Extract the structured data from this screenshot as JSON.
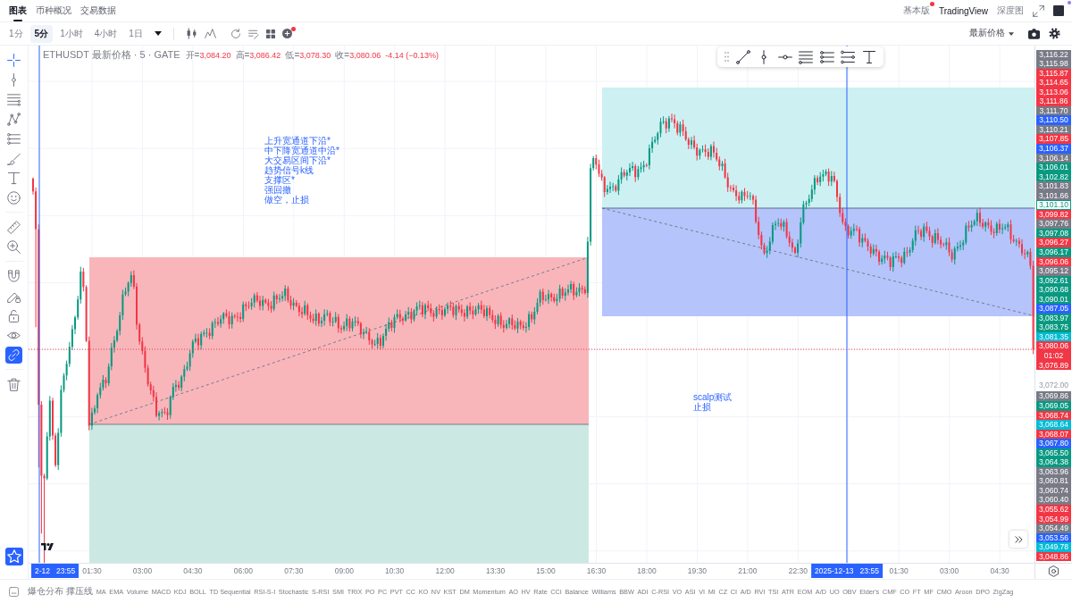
{
  "header_tabs": [
    {
      "label": "图表",
      "selected": true
    },
    {
      "label": "币种概况",
      "selected": false
    },
    {
      "label": "交易数据",
      "selected": false
    }
  ],
  "view_switch": [
    {
      "label": "基本版",
      "selected": false,
      "notification_dot": true
    },
    {
      "label": "TradingView",
      "selected": true,
      "notification_dot": false
    },
    {
      "label": "深度图",
      "selected": false,
      "notification_dot": false
    }
  ],
  "toolbar": {
    "intervals": [
      {
        "label": "1分",
        "selected": false
      },
      {
        "label": "5分",
        "selected": true
      },
      {
        "label": "1小时",
        "selected": false
      },
      {
        "label": "4小时",
        "selected": false
      },
      {
        "label": "1日",
        "selected": false
      }
    ],
    "add_indicator": {
      "notification_dot": true
    },
    "price_source": "最新价格"
  },
  "drawing_tools": [
    {
      "selected": true
    },
    {
      "selected": false
    },
    {
      "selected": false
    },
    {
      "selected": false
    },
    {
      "selected": false
    },
    {
      "selected": false
    },
    {
      "selected": false
    },
    {
      "selected": false
    },
    {
      "selected": false
    },
    {
      "selected": false
    }
  ],
  "toggles": [
    {
      "on": false
    },
    {
      "on": false
    },
    {
      "on": false
    },
    {
      "on": false
    },
    {
      "on": true
    }
  ],
  "legend": {
    "symbol": "ETHUSDT 最新价格 · 5 · GATE",
    "falling": true,
    "ohlc": [
      {
        "label": "开=",
        "value": "3,084.20"
      },
      {
        "label": "高=",
        "value": "3,086.42"
      },
      {
        "label": "低=",
        "value": "3,078.30"
      },
      {
        "label": "收=",
        "value": "3,080.06"
      }
    ],
    "change": "-4.14 (−0.13%)"
  },
  "annotations": [
    {
      "lines": [
        "上升宽通道下沿*",
        "中下降宽通道中沿*",
        "大交易区间下沿*",
        "趋势信号k线",
        "支撑区*",
        "强回撤",
        "做空，止损"
      ]
    },
    {
      "lines": [
        "scalp测试",
        "止损"
      ]
    }
  ],
  "price_axis": [
    {
      "text": "3,116.22",
      "kind": "tag",
      "color": "#787b86"
    },
    {
      "text": "3,115.98",
      "kind": "tag",
      "color": "#787b86"
    },
    {
      "text": "3,115.87",
      "kind": "tag",
      "color": "#f23645"
    },
    {
      "text": "3,114.65",
      "kind": "tag",
      "color": "#f23645"
    },
    {
      "text": "3,113.06",
      "kind": "tag",
      "color": "#f23645"
    },
    {
      "text": "3,111.86",
      "kind": "tag",
      "color": "#f23645"
    },
    {
      "text": "3,111.70",
      "kind": "tag",
      "color": "#787b86"
    },
    {
      "text": "3,110.50",
      "kind": "tag",
      "color": "#2962ff"
    },
    {
      "text": "3,110.21",
      "kind": "tag",
      "color": "#787b86"
    },
    {
      "text": "3,107.85",
      "kind": "tag",
      "color": "#f23645"
    },
    {
      "text": "3,106.37",
      "kind": "tag",
      "color": "#2962ff"
    },
    {
      "text": "3,106.14",
      "kind": "tag",
      "color": "#787b86"
    },
    {
      "text": "3,106.01",
      "kind": "tag",
      "color": "#089981"
    },
    {
      "text": "3,102.82",
      "kind": "tag",
      "color": "#089981"
    },
    {
      "text": "3,101.83",
      "kind": "tag",
      "color": "#787b86"
    },
    {
      "text": "3,101.66",
      "kind": "tag",
      "color": "#787b86"
    },
    {
      "text": "3,101.10",
      "kind": "outline",
      "color": "#089981"
    },
    {
      "text": "3,099.82",
      "kind": "tag",
      "color": "#f23645"
    },
    {
      "text": "3,097.76",
      "kind": "tag",
      "color": "#787b86"
    },
    {
      "text": "3,097.08",
      "kind": "tag",
      "color": "#089981"
    },
    {
      "text": "3,096.27",
      "kind": "tag",
      "color": "#f23645"
    },
    {
      "text": "3,096.17",
      "kind": "tag",
      "color": "#089981"
    },
    {
      "text": "3,096.06",
      "kind": "tag",
      "color": "#f23645"
    },
    {
      "text": "3,095.12",
      "kind": "tag",
      "color": "#787b86"
    },
    {
      "text": "3,092.61",
      "kind": "tag",
      "color": "#089981"
    },
    {
      "text": "3,090.68",
      "kind": "tag",
      "color": "#089981"
    },
    {
      "text": "3,090.01",
      "kind": "tag",
      "color": "#089981"
    },
    {
      "text": "3,087.05",
      "kind": "tag",
      "color": "#2962ff"
    },
    {
      "text": "3,083.97",
      "kind": "tag",
      "color": "#089981"
    },
    {
      "text": "3,083.75",
      "kind": "tag",
      "color": "#089981"
    },
    {
      "text": "3,081.35",
      "kind": "tag",
      "color": "#00bcd4"
    },
    {
      "text": "3,080.06",
      "kind": "current",
      "color": "#f23645",
      "countdown": "01:02"
    },
    {
      "text": "3,076.89",
      "kind": "tag",
      "color": "#f23645"
    },
    {
      "text": "3,072.00",
      "kind": "tick"
    },
    {
      "text": "3,069.86",
      "kind": "tag",
      "color": "#787b86"
    },
    {
      "text": "3,069.05",
      "kind": "tag",
      "color": "#089981"
    },
    {
      "text": "3,068.74",
      "kind": "tag",
      "color": "#f23645"
    },
    {
      "text": "3,068.64",
      "kind": "tag",
      "color": "#00bcd4"
    },
    {
      "text": "3,068.07",
      "kind": "tag",
      "color": "#f23645"
    },
    {
      "text": "3,067.80",
      "kind": "tag",
      "color": "#2962ff"
    },
    {
      "text": "3,065.50",
      "kind": "tag",
      "color": "#089981"
    },
    {
      "text": "3,064.38",
      "kind": "tag",
      "color": "#089981"
    },
    {
      "text": "3,063.96",
      "kind": "tag",
      "color": "#787b86"
    },
    {
      "text": "3,060.81",
      "kind": "tag",
      "color": "#787b86"
    },
    {
      "text": "3,060.74",
      "kind": "tag",
      "color": "#787b86"
    },
    {
      "text": "3,060.40",
      "kind": "tag",
      "color": "#787b86"
    },
    {
      "text": "3,055.62",
      "kind": "tag",
      "color": "#f23645"
    },
    {
      "text": "3,054.99",
      "kind": "tag",
      "color": "#f23645"
    },
    {
      "text": "3,054.49",
      "kind": "tag",
      "color": "#787b86"
    },
    {
      "text": "3,053.56",
      "kind": "tag",
      "color": "#2962ff"
    },
    {
      "text": "3,049.78",
      "kind": "tag",
      "color": "#00bcd4"
    },
    {
      "text": "3,048.86",
      "kind": "tag",
      "color": "#f23645"
    }
  ],
  "time_axis": [
    {
      "kind": "cursor",
      "date": "2-12",
      "time": "23:55"
    },
    {
      "kind": "tick",
      "text": "01:30"
    },
    {
      "kind": "tick",
      "text": "03:00"
    },
    {
      "kind": "tick",
      "text": "04:30"
    },
    {
      "kind": "tick",
      "text": "06:00"
    },
    {
      "kind": "tick",
      "text": "07:30"
    },
    {
      "kind": "tick",
      "text": "09:00"
    },
    {
      "kind": "tick",
      "text": "10:30"
    },
    {
      "kind": "tick",
      "text": "12:00"
    },
    {
      "kind": "tick",
      "text": "13:30"
    },
    {
      "kind": "tick",
      "text": "15:00"
    },
    {
      "kind": "tick",
      "text": "16:30"
    },
    {
      "kind": "tick",
      "text": "18:00"
    },
    {
      "kind": "tick",
      "text": "19:30"
    },
    {
      "kind": "tick",
      "text": "21:00"
    },
    {
      "kind": "tick",
      "text": "22:30"
    },
    {
      "kind": "cursor",
      "date": "2025-12-13",
      "time": "23:55"
    },
    {
      "kind": "tick",
      "text": "01:30"
    },
    {
      "kind": "tick",
      "text": "03:00"
    },
    {
      "kind": "tick",
      "text": "04:30"
    }
  ],
  "indicators": [
    "爆仓分布",
    "撑压线",
    "MA",
    "EMA",
    "Volume",
    "MACD",
    "KDJ",
    "BOLL",
    "TD Sequential",
    "RSI-S-I",
    "Stochastic",
    "S-RSI",
    "SMI",
    "TRIX",
    "PO",
    "PC",
    "PVT",
    "CC",
    "KO",
    "NV",
    "KST",
    "DM",
    "Momentum",
    "AO",
    "HV",
    "Rate",
    "CCI",
    "Balance",
    "Williams",
    "BBW",
    "ADI",
    "C-RSI",
    "VO",
    "ASI",
    "VI",
    "MI",
    "CZ",
    "CI",
    "A/D",
    "RVI",
    "TSI",
    "ATR",
    "EOM",
    "A/D",
    "UO",
    "OBV",
    "Elder's",
    "CMF",
    "CO",
    "FT",
    "MF",
    "CMO",
    "Aroon",
    "DPO",
    "ZigZag"
  ]
}
